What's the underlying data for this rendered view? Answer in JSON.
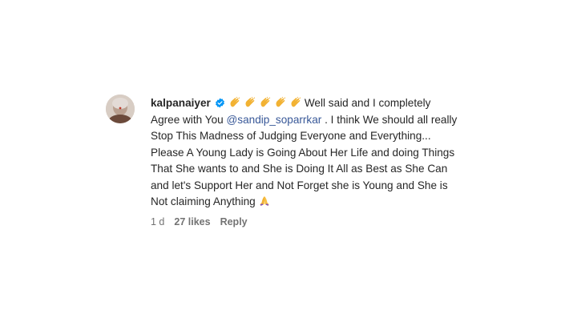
{
  "comment": {
    "username": "kalpanaiyer",
    "verified_icon": "verified-badge-icon",
    "clap_icon": "clapping-hands-emoji",
    "clap_count": 5,
    "text_before_mention": "Well said and I completely Agree with You",
    "mention": "@sandip_soparrkar",
    "text_after_mention": ". I think We should all really Stop This Madness of Judging Everyone and Everything... Please A Young Lady is Going About Her Life and doing Things That She wants to and She is Doing It All as Best as She Can and let's Support Her and Not Forget she is Young and She is Not claiming Anything",
    "pray_icon": "folded-hands-emoji",
    "time": "1 d",
    "likes": "27 likes",
    "reply_label": "Reply"
  },
  "colors": {
    "text": "#262626",
    "mention": "#385898",
    "meta": "#737373",
    "verified": "#0095f6"
  }
}
